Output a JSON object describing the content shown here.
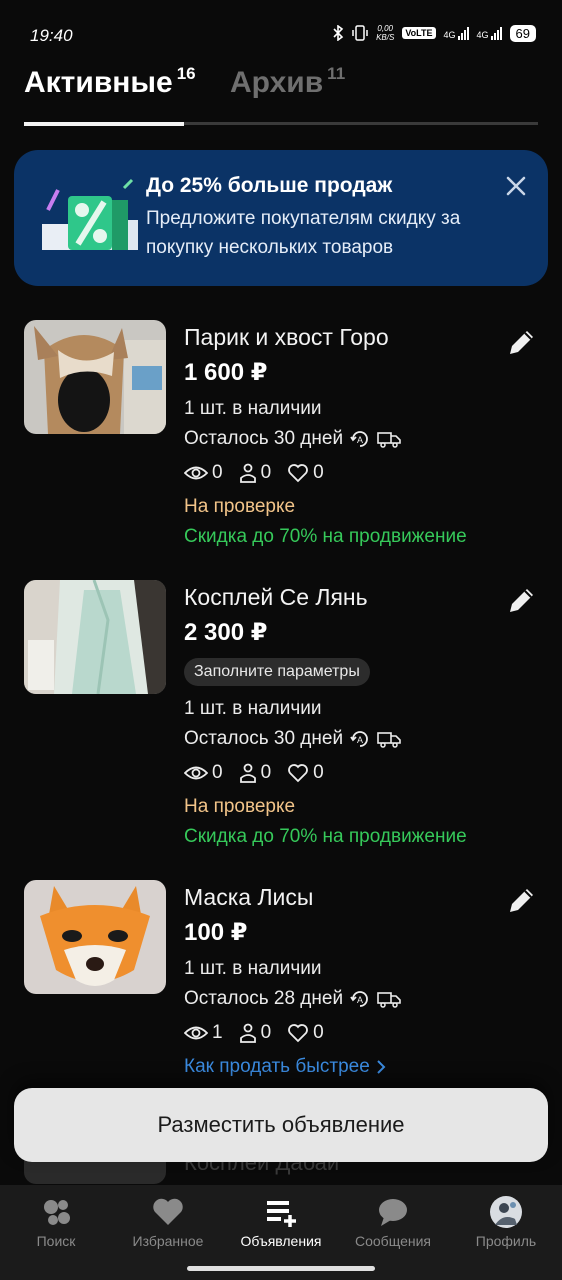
{
  "status_bar": {
    "time": "19:40",
    "net_speed_value": "0,00",
    "net_speed_unit": "KB/S",
    "volte": "VoLTE",
    "sim1": "4G",
    "sim2": "4G",
    "battery": "69"
  },
  "tabs": [
    {
      "label": "Активные",
      "count": "16"
    },
    {
      "label": "Архив",
      "count": "11"
    }
  ],
  "banner": {
    "title": "До 25% больше продаж",
    "text": "Предложите покупателям скидку за покупку нескольких товаров",
    "art_icon": "percent-discount-icon"
  },
  "listings": [
    {
      "title": "Парик и хвост Горо",
      "price": "1 600 ₽",
      "stock": "1 шт. в наличии",
      "days_left": "Осталось 30 дней",
      "views": "0",
      "contacts": "0",
      "favorites": "0",
      "status": "На проверке",
      "promo": "Скидка до 70% на продвижение"
    },
    {
      "title": "Косплей Се Лянь",
      "price": "2 300 ₽",
      "chip": "Заполните параметры",
      "stock": "1 шт. в наличии",
      "days_left": "Осталось 30 дней",
      "views": "0",
      "contacts": "0",
      "favorites": "0",
      "status": "На проверке",
      "promo": "Скидка до 70% на продвижение"
    },
    {
      "title": "Маска Лисы",
      "price": "100 ₽",
      "stock": "1 шт. в наличии",
      "days_left": "Осталось 28 дней",
      "views": "1",
      "contacts": "0",
      "favorites": "0",
      "link": "Как продать быстрее"
    }
  ],
  "partial_listing_title": "Косплей Дабай",
  "post_button": "Разместить объявление",
  "nav": [
    {
      "label": "Поиск",
      "icon": "search-dots-icon"
    },
    {
      "label": "Избранное",
      "icon": "heart-icon"
    },
    {
      "label": "Объявления",
      "icon": "listings-add-icon",
      "active": true
    },
    {
      "label": "Сообщения",
      "icon": "chat-bubble-icon"
    },
    {
      "label": "Профиль",
      "icon": "avatar"
    }
  ],
  "colors": {
    "background": "#0a0a0a",
    "banner": "#0b3366",
    "status_review": "#f2c489",
    "promo_green": "#36c95a",
    "link_blue": "#3b8be0"
  }
}
